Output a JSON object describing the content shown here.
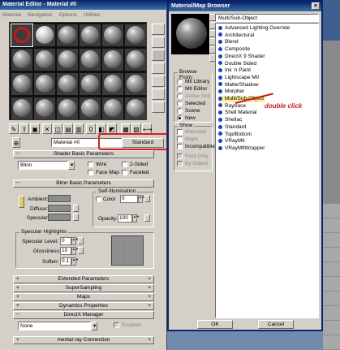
{
  "material_editor": {
    "title": "Material Editor - Material #0",
    "menu": [
      "Material",
      "Navigation",
      "Options",
      "Utilities"
    ],
    "material_name": "Material #0",
    "type_button": "Standard",
    "rollouts": {
      "shader_basic": "Shader Basic Parameters",
      "shader_type": "Blinn",
      "wire": "Wire",
      "two_sided": "2-Sided",
      "face_map": "Face Map",
      "faceted": "Faceted",
      "blinn_basic": "Blinn Basic Parameters",
      "self_illum": "Self-Illumination",
      "color": "Color",
      "color_value": "0",
      "ambient": "Ambient:",
      "diffuse": "Diffuse:",
      "specular": "Specular:",
      "opacity": "Opacity:",
      "opacity_value": "100",
      "specular_highlights": "Specular Highlights",
      "specular_level": "Specular Level:",
      "specular_level_value": "0",
      "glossiness": "Glossiness:",
      "glossiness_value": "10",
      "soften": "Soften:",
      "soften_value": "0.1",
      "extended": "Extended Parameters",
      "supersampling": "SuperSampling",
      "maps": "Maps",
      "dynamics": "Dynamics Properties",
      "directx": "DirectX Manager",
      "dx_value": "None",
      "enabled": "Enabled",
      "mental_ray": "mental ray Connection"
    }
  },
  "browser": {
    "title": "Material/Map Browser",
    "header": "Multi/Sub-Object",
    "browse_from": "Browse From:",
    "browse_options": [
      "Mtl Library",
      "Mtl Editor",
      "Active Slot",
      "Selected",
      "Scene",
      "New"
    ],
    "browse_selected": "New",
    "show": "Show",
    "show_options": [
      "Materials",
      "Maps",
      "Incompatible"
    ],
    "show_options2": [
      "Root Only",
      "By Object"
    ],
    "items": [
      "Advanced Lighting Override",
      "Architectural",
      "Blend",
      "Composite",
      "DirectX 9 Shader",
      "Double Sided",
      "Ink 'n Paint",
      "Lightscape Mtl",
      "Matte/Shadow",
      "Morpher",
      "Multi/Sub-Object",
      "Raytrace",
      "Shell Material",
      "Shellac",
      "Standard",
      "Top/Bottom",
      "VRayMtl",
      "VRayMtlWrapper"
    ],
    "selected_item": "Multi/Sub-Object",
    "ok": "OK",
    "cancel": "Cancel"
  },
  "annotation": "double click",
  "colors": {
    "annotation": "#c61c1c",
    "highlight": "#ffef9e",
    "title_bar": "#0a246a",
    "item_dot": "#1d3fc9"
  }
}
